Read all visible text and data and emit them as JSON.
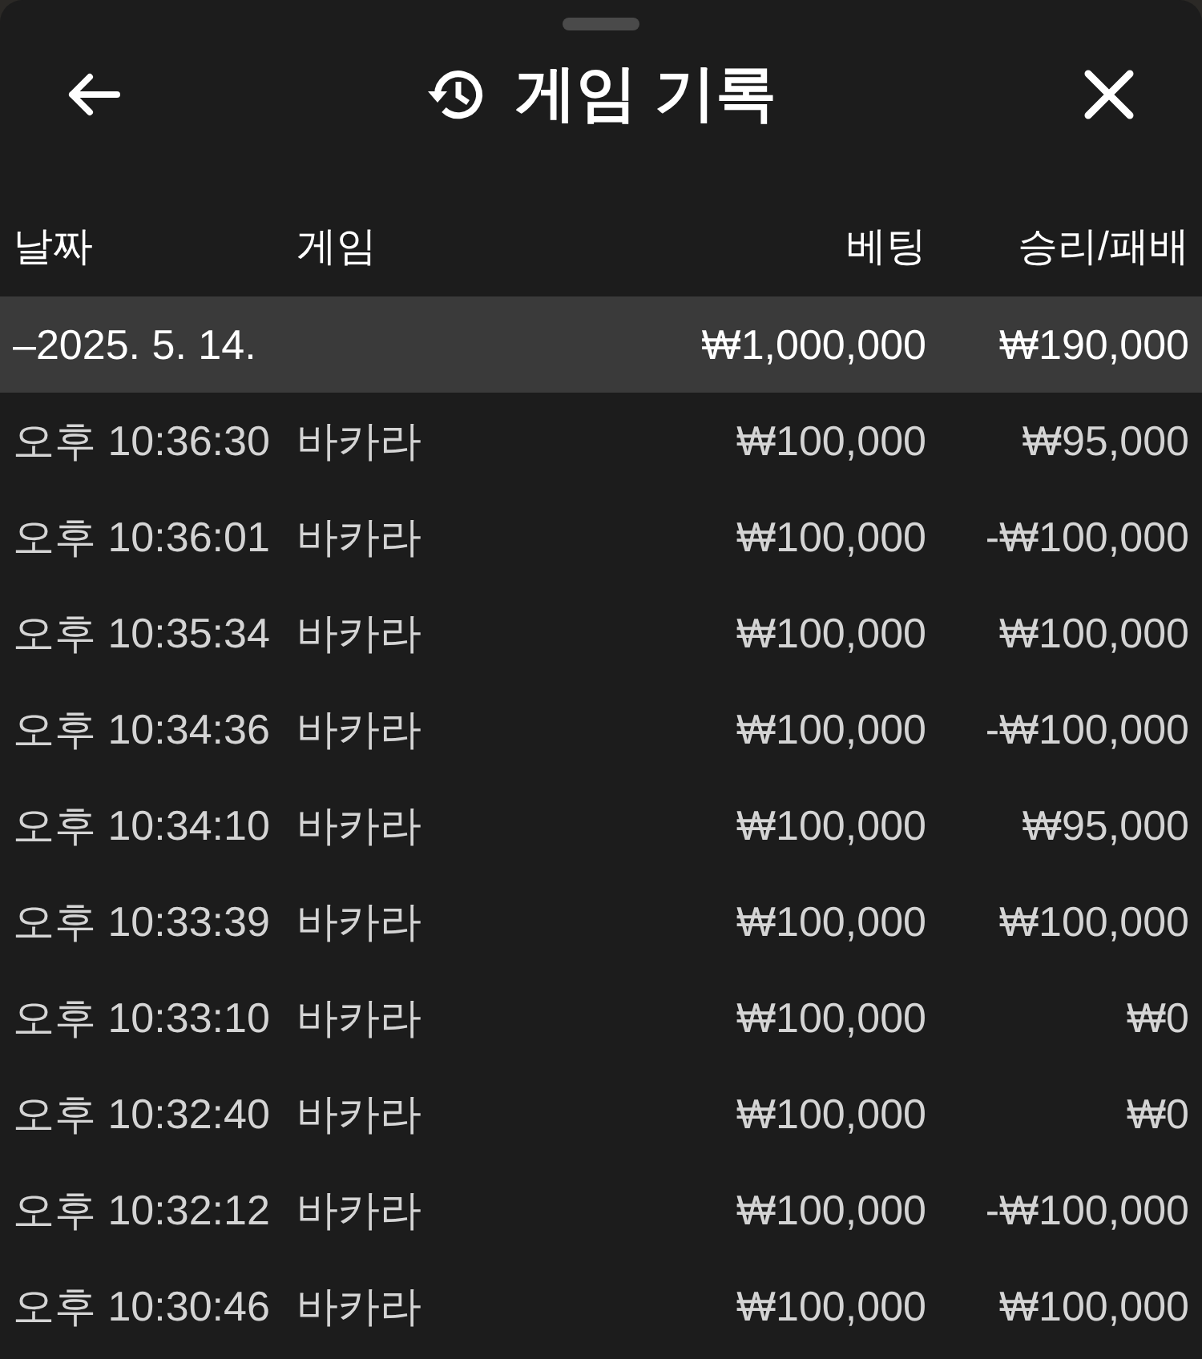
{
  "header": {
    "title": "게임 기록"
  },
  "table": {
    "columns": [
      "날짜",
      "게임",
      "베팅",
      "승리/패배"
    ],
    "group": {
      "date": "–2025. 5. 14.",
      "bet": "₩1,000,000",
      "result": "₩190,000"
    },
    "rows": [
      {
        "time": "오후 10:36:30",
        "game": "바카라",
        "bet": "₩100,000",
        "result": "₩95,000"
      },
      {
        "time": "오후 10:36:01",
        "game": "바카라",
        "bet": "₩100,000",
        "result": "-₩100,000"
      },
      {
        "time": "오후 10:35:34",
        "game": "바카라",
        "bet": "₩100,000",
        "result": "₩100,000"
      },
      {
        "time": "오후 10:34:36",
        "game": "바카라",
        "bet": "₩100,000",
        "result": "-₩100,000"
      },
      {
        "time": "오후 10:34:10",
        "game": "바카라",
        "bet": "₩100,000",
        "result": "₩95,000"
      },
      {
        "time": "오후 10:33:39",
        "game": "바카라",
        "bet": "₩100,000",
        "result": "₩100,000"
      },
      {
        "time": "오후 10:33:10",
        "game": "바카라",
        "bet": "₩100,000",
        "result": "₩0"
      },
      {
        "time": "오후 10:32:40",
        "game": "바카라",
        "bet": "₩100,000",
        "result": "₩0"
      },
      {
        "time": "오후 10:32:12",
        "game": "바카라",
        "bet": "₩100,000",
        "result": "-₩100,000"
      },
      {
        "time": "오후 10:30:46",
        "game": "바카라",
        "bet": "₩100,000",
        "result": "₩100,000"
      }
    ]
  }
}
